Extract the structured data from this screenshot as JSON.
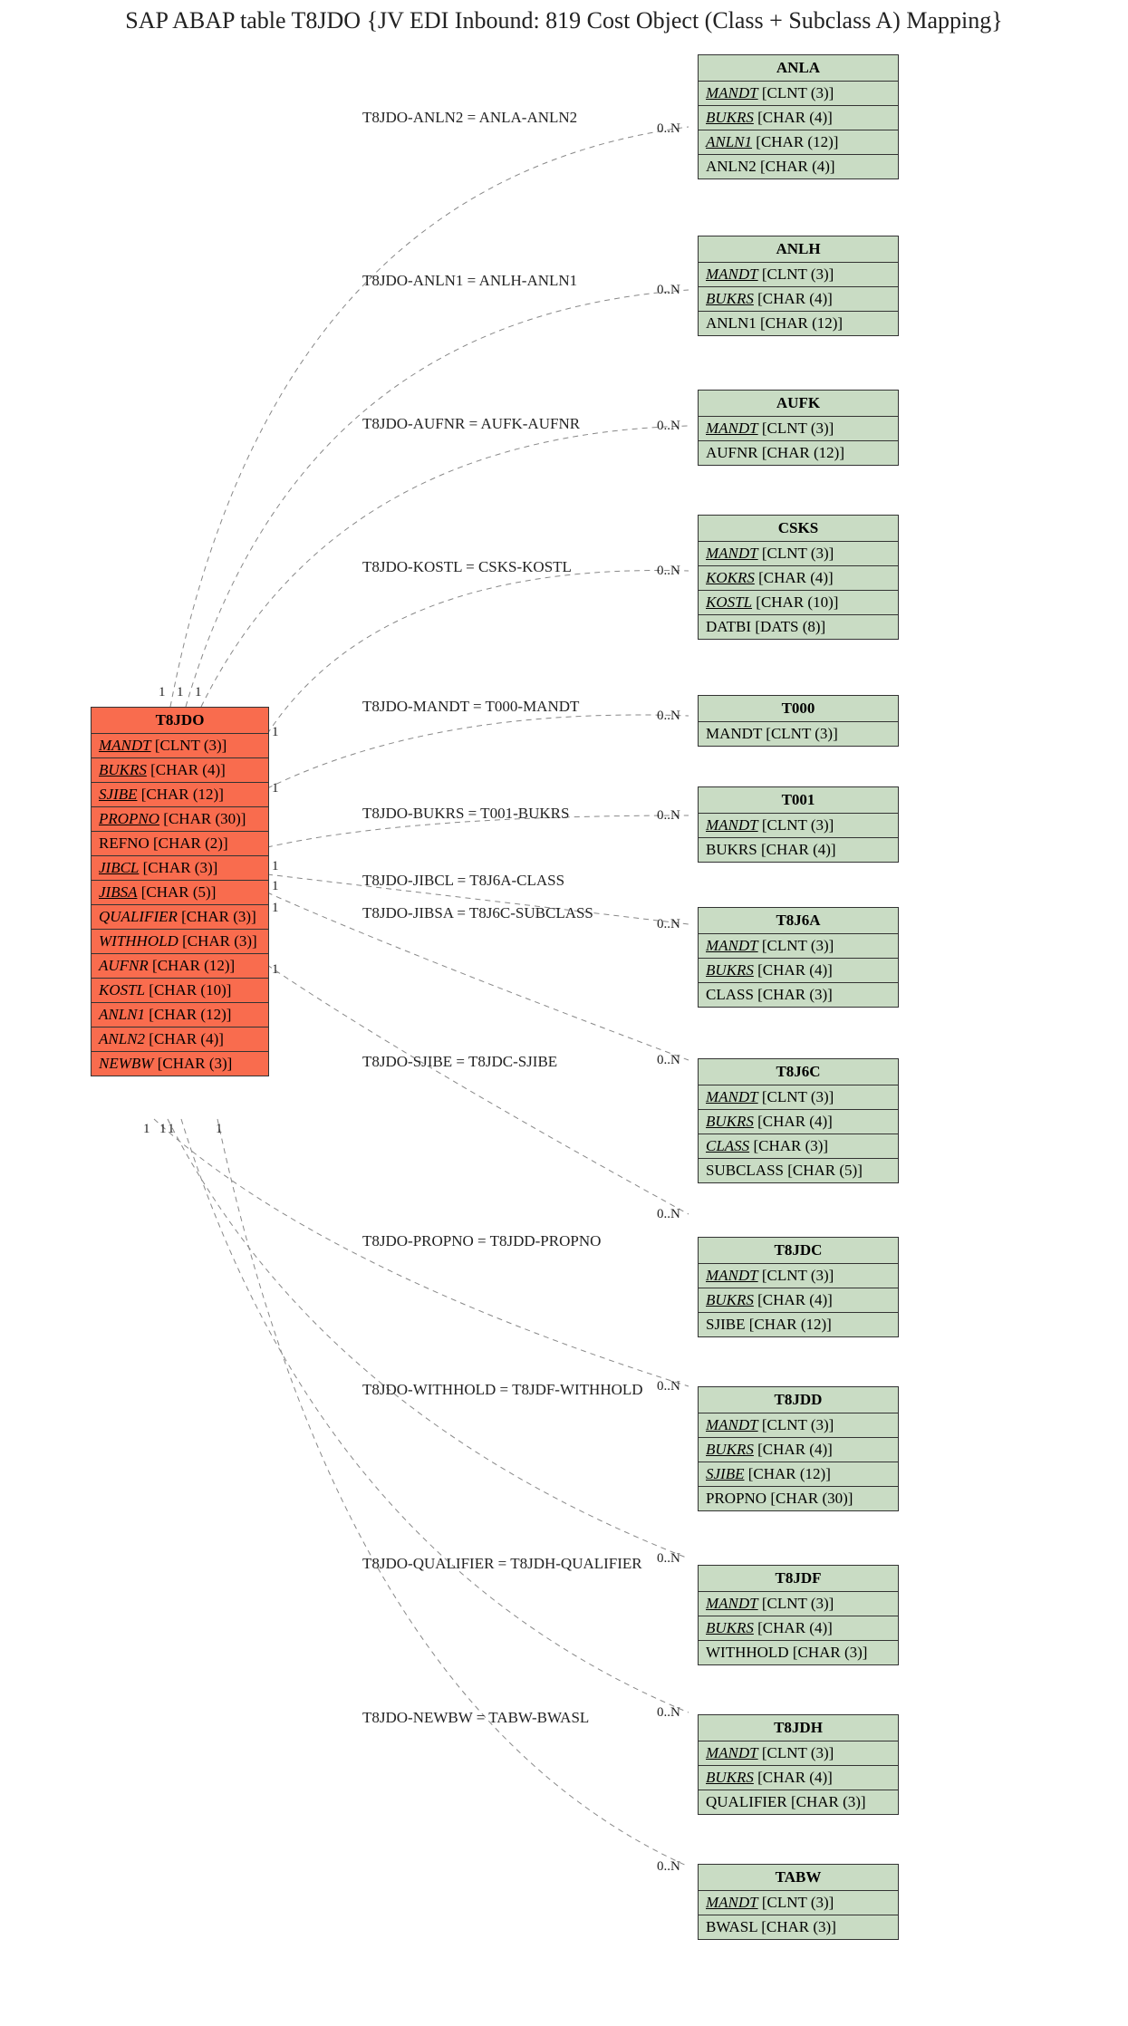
{
  "title": "SAP ABAP table T8JDO {JV EDI Inbound: 819 Cost Object (Class + Subclass A) Mapping}",
  "main": {
    "name": "T8JDO",
    "fields": [
      {
        "name": "MANDT",
        "type": "[CLNT (3)]",
        "key": true
      },
      {
        "name": "BUKRS",
        "type": "[CHAR (4)]",
        "key": true
      },
      {
        "name": "SJIBE",
        "type": "[CHAR (12)]",
        "key": true
      },
      {
        "name": "PROPNO",
        "type": "[CHAR (30)]",
        "key": true
      },
      {
        "name": "REFNO",
        "type": "[CHAR (2)]",
        "key": false
      },
      {
        "name": "JIBCL",
        "type": "[CHAR (3)]",
        "key": true
      },
      {
        "name": "JIBSA",
        "type": "[CHAR (5)]",
        "key": true
      },
      {
        "name": "QUALIFIER",
        "type": "[CHAR (3)]",
        "fkey": true
      },
      {
        "name": "WITHHOLD",
        "type": "[CHAR (3)]",
        "fkey": true
      },
      {
        "name": "AUFNR",
        "type": "[CHAR (12)]",
        "fkey": true
      },
      {
        "name": "KOSTL",
        "type": "[CHAR (10)]",
        "fkey": true
      },
      {
        "name": "ANLN1",
        "type": "[CHAR (12)]",
        "fkey": true
      },
      {
        "name": "ANLN2",
        "type": "[CHAR (4)]",
        "fkey": true
      },
      {
        "name": "NEWBW",
        "type": "[CHAR (3)]",
        "fkey": true
      }
    ]
  },
  "targets": [
    {
      "name": "ANLA",
      "fields": [
        {
          "name": "MANDT",
          "type": "[CLNT (3)]",
          "key": true
        },
        {
          "name": "BUKRS",
          "type": "[CHAR (4)]",
          "key": true
        },
        {
          "name": "ANLN1",
          "type": "[CHAR (12)]",
          "key": true
        },
        {
          "name": "ANLN2",
          "type": "[CHAR (4)]",
          "key": false
        }
      ]
    },
    {
      "name": "ANLH",
      "fields": [
        {
          "name": "MANDT",
          "type": "[CLNT (3)]",
          "key": true
        },
        {
          "name": "BUKRS",
          "type": "[CHAR (4)]",
          "key": true
        },
        {
          "name": "ANLN1",
          "type": "[CHAR (12)]",
          "key": false
        }
      ]
    },
    {
      "name": "AUFK",
      "fields": [
        {
          "name": "MANDT",
          "type": "[CLNT (3)]",
          "key": true
        },
        {
          "name": "AUFNR",
          "type": "[CHAR (12)]",
          "key": false
        }
      ]
    },
    {
      "name": "CSKS",
      "fields": [
        {
          "name": "MANDT",
          "type": "[CLNT (3)]",
          "key": true
        },
        {
          "name": "KOKRS",
          "type": "[CHAR (4)]",
          "key": true
        },
        {
          "name": "KOSTL",
          "type": "[CHAR (10)]",
          "key": true
        },
        {
          "name": "DATBI",
          "type": "[DATS (8)]",
          "key": false
        }
      ]
    },
    {
      "name": "T000",
      "fields": [
        {
          "name": "MANDT",
          "type": "[CLNT (3)]",
          "key": false
        }
      ]
    },
    {
      "name": "T001",
      "fields": [
        {
          "name": "MANDT",
          "type": "[CLNT (3)]",
          "key": true
        },
        {
          "name": "BUKRS",
          "type": "[CHAR (4)]",
          "key": false
        }
      ]
    },
    {
      "name": "T8J6A",
      "fields": [
        {
          "name": "MANDT",
          "type": "[CLNT (3)]",
          "key": true
        },
        {
          "name": "BUKRS",
          "type": "[CHAR (4)]",
          "key": true
        },
        {
          "name": "CLASS",
          "type": "[CHAR (3)]",
          "key": false
        }
      ]
    },
    {
      "name": "T8J6C",
      "fields": [
        {
          "name": "MANDT",
          "type": "[CLNT (3)]",
          "key": true
        },
        {
          "name": "BUKRS",
          "type": "[CHAR (4)]",
          "key": true
        },
        {
          "name": "CLASS",
          "type": "[CHAR (3)]",
          "key": true
        },
        {
          "name": "SUBCLASS",
          "type": "[CHAR (5)]",
          "key": false
        }
      ]
    },
    {
      "name": "T8JDC",
      "fields": [
        {
          "name": "MANDT",
          "type": "[CLNT (3)]",
          "key": true
        },
        {
          "name": "BUKRS",
          "type": "[CHAR (4)]",
          "key": true
        },
        {
          "name": "SJIBE",
          "type": "[CHAR (12)]",
          "key": false
        }
      ]
    },
    {
      "name": "T8JDD",
      "fields": [
        {
          "name": "MANDT",
          "type": "[CLNT (3)]",
          "key": true
        },
        {
          "name": "BUKRS",
          "type": "[CHAR (4)]",
          "key": true
        },
        {
          "name": "SJIBE",
          "type": "[CHAR (12)]",
          "key": true
        },
        {
          "name": "PROPNO",
          "type": "[CHAR (30)]",
          "key": false
        }
      ]
    },
    {
      "name": "T8JDF",
      "fields": [
        {
          "name": "MANDT",
          "type": "[CLNT (3)]",
          "key": true
        },
        {
          "name": "BUKRS",
          "type": "[CHAR (4)]",
          "key": true
        },
        {
          "name": "WITHHOLD",
          "type": "[CHAR (3)]",
          "key": false
        }
      ]
    },
    {
      "name": "T8JDH",
      "fields": [
        {
          "name": "MANDT",
          "type": "[CLNT (3)]",
          "key": true
        },
        {
          "name": "BUKRS",
          "type": "[CHAR (4)]",
          "key": true
        },
        {
          "name": "QUALIFIER",
          "type": "[CHAR (3)]",
          "key": false
        }
      ]
    },
    {
      "name": "TABW",
      "fields": [
        {
          "name": "MANDT",
          "type": "[CLNT (3)]",
          "key": true
        },
        {
          "name": "BWASL",
          "type": "[CHAR (3)]",
          "key": false
        }
      ]
    }
  ],
  "relationships": [
    {
      "label": "T8JDO-ANLN2 = ANLA-ANLN2",
      "card": "0..N"
    },
    {
      "label": "T8JDO-ANLN1 = ANLH-ANLN1",
      "card": "0..N"
    },
    {
      "label": "T8JDO-AUFNR = AUFK-AUFNR",
      "card": "0..N"
    },
    {
      "label": "T8JDO-KOSTL = CSKS-KOSTL",
      "card": "0..N"
    },
    {
      "label": "T8JDO-MANDT = T000-MANDT",
      "card": "0..N"
    },
    {
      "label": "T8JDO-BUKRS = T001-BUKRS",
      "card": "0..N"
    },
    {
      "label": "T8JDO-JIBCL = T8J6A-CLASS",
      "card": "0..N"
    },
    {
      "label": "T8JDO-JIBSA = T8J6C-SUBCLASS",
      "card": ""
    },
    {
      "label": "T8JDO-SJIBE = T8JDC-SJIBE",
      "card": "0..N"
    },
    {
      "label": "T8JDO-PROPNO = T8JDD-PROPNO",
      "card": "0..N"
    },
    {
      "label": "T8JDO-WITHHOLD = T8JDF-WITHHOLD",
      "card": "0..N"
    },
    {
      "label": "T8JDO-QUALIFIER = T8JDH-QUALIFIER",
      "card": "0..N"
    },
    {
      "label": "T8JDO-NEWBW = TABW-BWASL",
      "card": "0..N"
    }
  ],
  "leftCards": {
    "top": [
      "1",
      "1",
      "1"
    ],
    "right": [
      "1",
      "1",
      "1",
      "1",
      "1",
      "1"
    ],
    "bottom": [
      "1",
      "1",
      "1",
      "1"
    ]
  }
}
